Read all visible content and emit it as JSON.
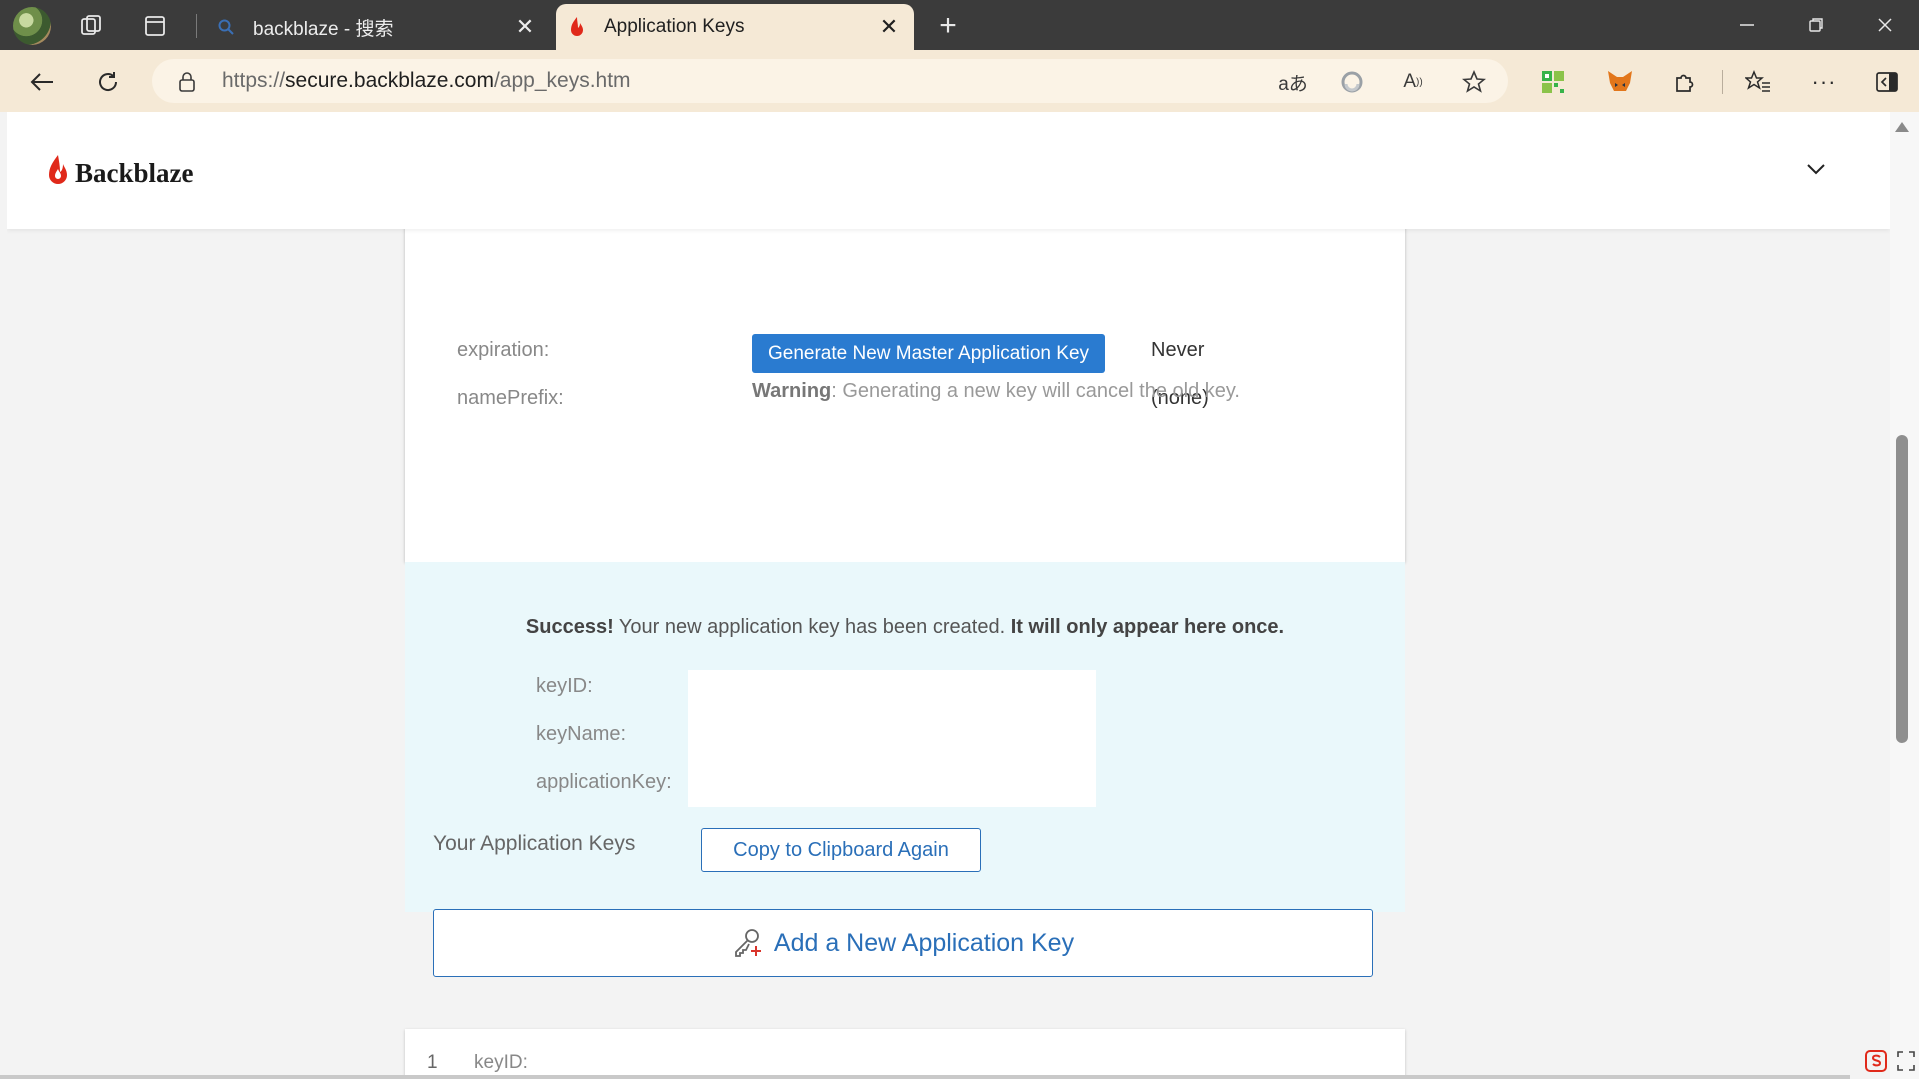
{
  "browser": {
    "tabs": [
      {
        "title": "backblaze - 搜索",
        "icon": "search-icon",
        "active": false
      },
      {
        "title": "Application Keys",
        "icon": "backblaze-flame-icon",
        "active": true
      }
    ],
    "url_prefix": "https://",
    "url_domain": "secure.backblaze.com",
    "url_path": "/app_keys.htm",
    "colors": {
      "tabbar": "#3b3b3b",
      "toolbar": "#f5e9d6",
      "accent_blue": "#2a7bd0"
    }
  },
  "site": {
    "logo_text": "Backblaze",
    "brand_color": "#e0291a"
  },
  "master_key": {
    "expiration_label": "expiration:",
    "expiration_value": "Never",
    "name_prefix_label": "namePrefix:",
    "name_prefix_value": "(none)",
    "generate_button": "Generate New Master Application Key",
    "warning_title": "Warning",
    "warning_text": ": Generating a new key will cancel the old key."
  },
  "new_key": {
    "success_title": "Success!",
    "success_text": " Your new application key has been created. ",
    "success_emphasis": "It will only appear here once.",
    "key_id_label": "keyID:",
    "key_name_label": "keyName:",
    "application_key_label": "applicationKey:",
    "copy_button": "Copy to Clipboard Again"
  },
  "keys_section": {
    "title": "Your Application Keys",
    "add_button": "Add a New Application Key",
    "first_item_index": "1",
    "first_item_label": "keyID:"
  }
}
